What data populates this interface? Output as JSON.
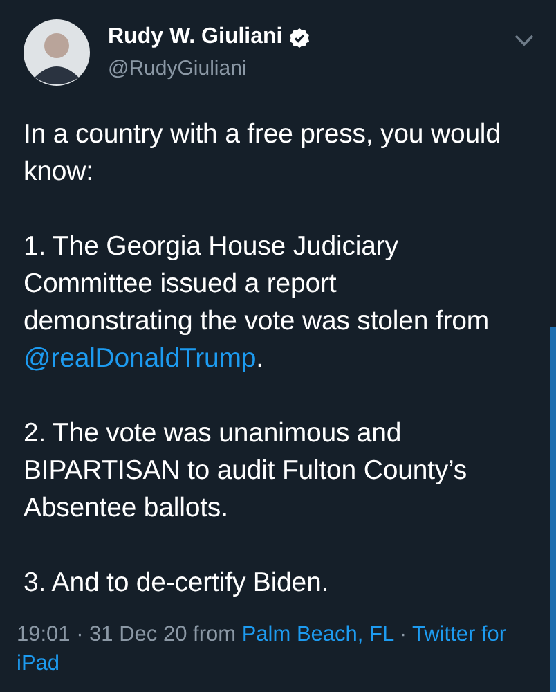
{
  "author": {
    "name": "Rudy W. Giuliani",
    "verified": true,
    "handle": "@RudyGiuliani"
  },
  "paragraphs": [
    [
      {
        "kind": "text",
        "text": "In a country with a free press, you would know:"
      }
    ],
    [
      {
        "kind": "text",
        "text": "1. The Georgia House Judiciary Committee issued a report demonstrating the vote was stolen from "
      },
      {
        "kind": "mention",
        "text": "@realDonaldTrump"
      },
      {
        "kind": "text",
        "text": "."
      }
    ],
    [
      {
        "kind": "text",
        "text": "2. The vote was unanimous and BIPARTISAN to audit Fulton County’s Absentee ballots."
      }
    ],
    [
      {
        "kind": "text",
        "text": "3. And to de-certify Biden."
      }
    ]
  ],
  "meta": [
    {
      "kind": "text",
      "text": "19:01 · 31 Dec 20 from "
    },
    {
      "kind": "link",
      "text": "Palm Beach, FL"
    },
    {
      "kind": "text",
      "text": " · "
    },
    {
      "kind": "link",
      "text": "Twitter for iPad"
    }
  ]
}
